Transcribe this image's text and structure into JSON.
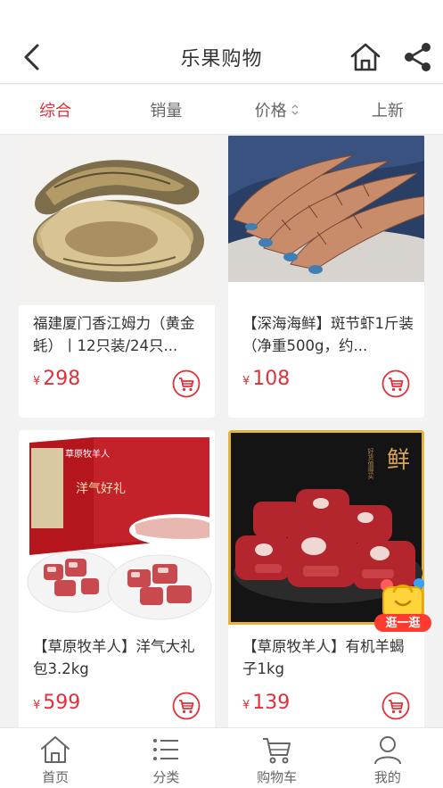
{
  "header": {
    "title": "乐果购物"
  },
  "sort": {
    "items": [
      {
        "label": "综合"
      },
      {
        "label": "销量"
      },
      {
        "label": "价格"
      },
      {
        "label": "上新"
      }
    ]
  },
  "products": [
    {
      "name": "福建厦门香江姆力（黄金蚝）丨12只装/24只...",
      "currency": "¥",
      "price": "298"
    },
    {
      "name": "【深海海鲜】斑节虾1斤装（净重500g，约...",
      "currency": "¥",
      "price": "108"
    },
    {
      "name": "【草原牧羊人】洋气大礼包3.2kg",
      "currency": "¥",
      "price": "599"
    },
    {
      "name": "【草原牧羊人】有机羊蝎子1kg",
      "currency": "¥",
      "price": "139"
    }
  ],
  "image_text": {
    "gift_box_brand": "草原牧羊人",
    "gift_box_label": "洋气好礼",
    "meat_big_char": "鲜",
    "meat_side_text": "好货值得买"
  },
  "float_badge": {
    "label": "逛一逛"
  },
  "tabbar": {
    "items": [
      {
        "label": "首页",
        "icon": "home-icon"
      },
      {
        "label": "分类",
        "icon": "category-list-icon"
      },
      {
        "label": "购物车",
        "icon": "shopping-cart-icon"
      },
      {
        "label": "我的",
        "icon": "user-profile-icon"
      }
    ]
  },
  "colors": {
    "accent": "#e0303a",
    "text": "#333333",
    "muted": "#666666",
    "background": "#f2f2f2"
  }
}
